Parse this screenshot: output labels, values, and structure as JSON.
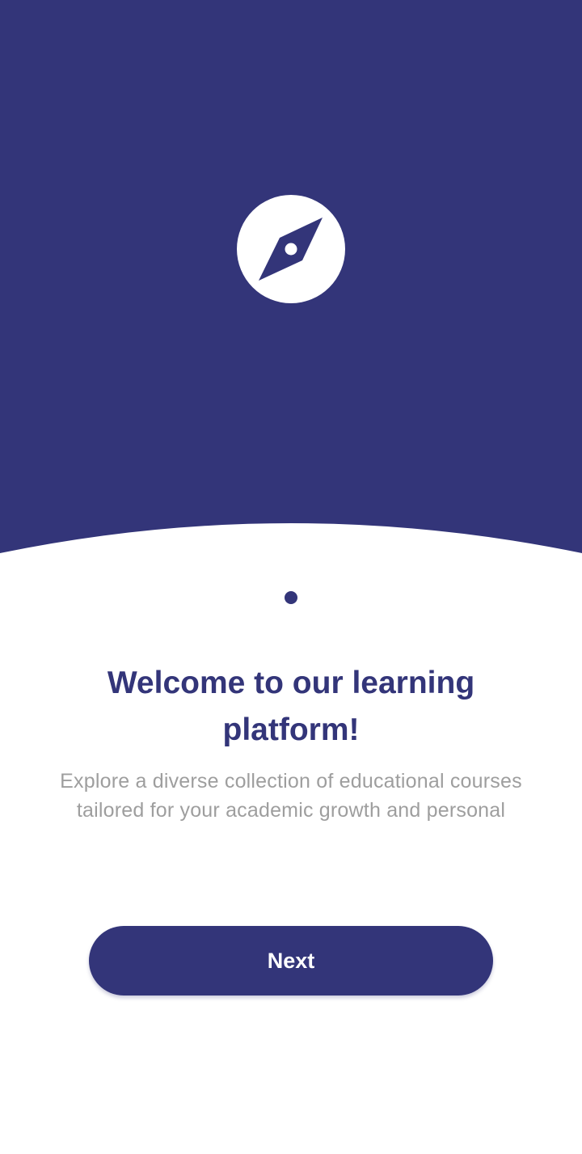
{
  "theme": {
    "primary_color": "#333579",
    "background_color": "#ffffff",
    "subtitle_color": "#9e9e9e"
  },
  "hero": {
    "logo_icon": "compass-icon"
  },
  "pager": {
    "page_count": 1,
    "current_page": 1
  },
  "onboarding": {
    "title": "Welcome to our learning platform!",
    "subtitle": "Explore a diverse collection of educational courses tailored for your academic growth and personal"
  },
  "actions": {
    "next_label": "Next"
  }
}
